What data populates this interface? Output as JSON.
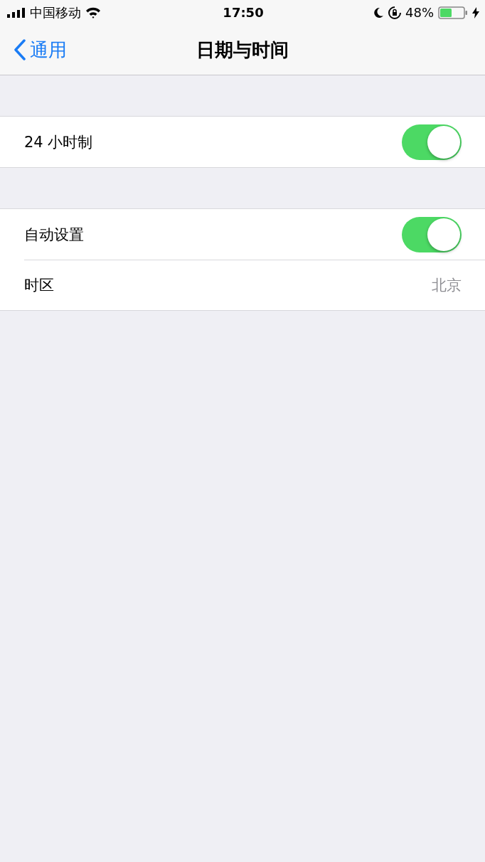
{
  "status_bar": {
    "carrier": "中国移动",
    "time": "17:50",
    "battery_percent": "48%"
  },
  "nav_bar": {
    "back_label": "通用",
    "title": "日期与时间"
  },
  "groups": [
    {
      "rows": [
        {
          "kind": "toggle",
          "label": "24 小时制",
          "on": true
        }
      ]
    },
    {
      "rows": [
        {
          "kind": "toggle",
          "label": "自动设置",
          "on": true
        },
        {
          "kind": "value",
          "label": "时区",
          "value": "北京"
        }
      ]
    }
  ]
}
